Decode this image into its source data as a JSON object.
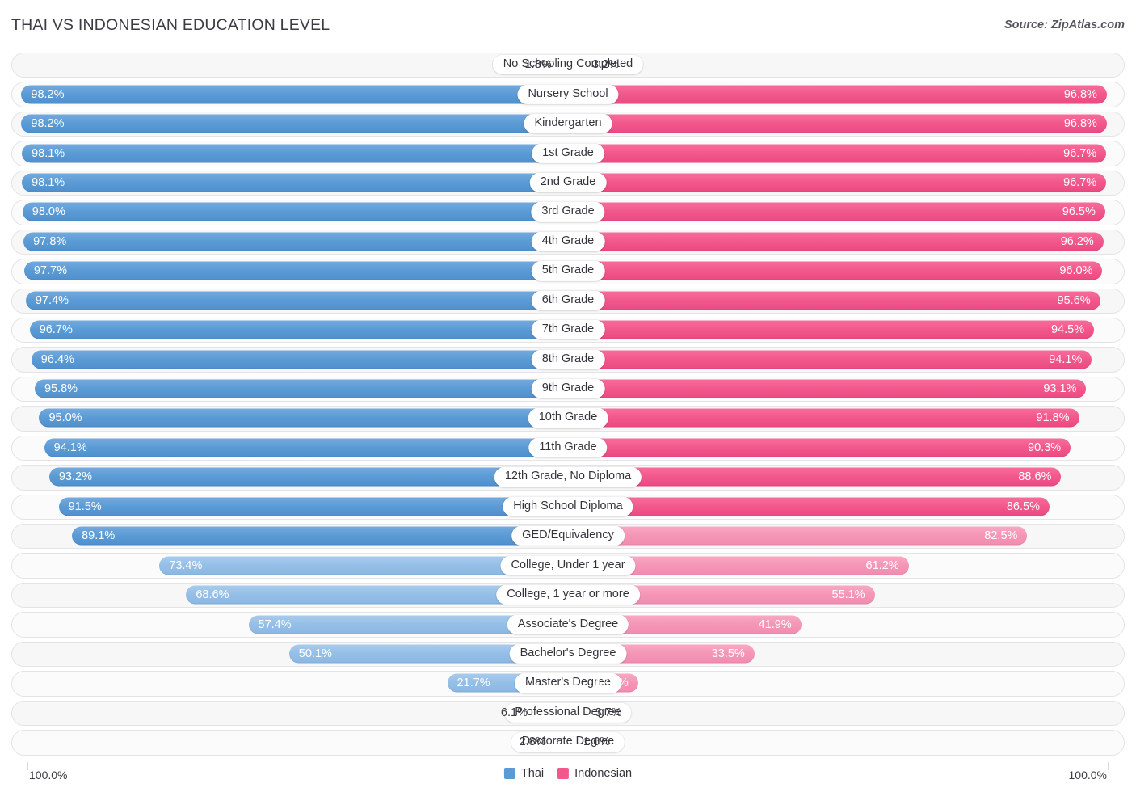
{
  "header": {
    "title": "THAI VS INDONESIAN EDUCATION LEVEL",
    "source": "Source: ZipAtlas.com"
  },
  "footer": {
    "axis_left": "100.0%",
    "axis_right": "100.0%",
    "legend": [
      {
        "label": "Thai",
        "color": "#5b9bd5"
      },
      {
        "label": "Indonesian",
        "color": "#f2588c"
      }
    ]
  },
  "colors": {
    "thai_strong": "#5b9bd5",
    "thai_pale": "#95bfe7",
    "indonesian_strong": "#f2588c",
    "indonesian_pale": "#f595b6",
    "track": "#f7f7f8",
    "text": "#33333b"
  },
  "chart_data": {
    "type": "bar",
    "orientation": "horizontal-diverging",
    "title": "THAI VS INDONESIAN EDUCATION LEVEL",
    "xlabel": "",
    "ylabel": "",
    "xlim": [
      0,
      100
    ],
    "grid": false,
    "legend_position": "bottom-center",
    "axis_max_label": "100.0%",
    "categories": [
      "No Schooling Completed",
      "Nursery School",
      "Kindergarten",
      "1st Grade",
      "2nd Grade",
      "3rd Grade",
      "4th Grade",
      "5th Grade",
      "6th Grade",
      "7th Grade",
      "8th Grade",
      "9th Grade",
      "10th Grade",
      "11th Grade",
      "12th Grade, No Diploma",
      "High School Diploma",
      "GED/Equivalency",
      "College, Under 1 year",
      "College, 1 year or more",
      "Associate's Degree",
      "Bachelor's Degree",
      "Master's Degree",
      "Professional Degree",
      "Doctorate Degree"
    ],
    "series": [
      {
        "name": "Thai",
        "color": "#5b9bd5",
        "side": "left",
        "values": [
          1.8,
          98.2,
          98.2,
          98.1,
          98.1,
          98.0,
          97.8,
          97.7,
          97.4,
          96.7,
          96.4,
          95.8,
          95.0,
          94.1,
          93.2,
          91.5,
          89.1,
          73.4,
          68.6,
          57.4,
          50.1,
          21.7,
          6.1,
          2.8
        ],
        "labels": [
          "1.8%",
          "98.2%",
          "98.2%",
          "98.1%",
          "98.1%",
          "98.0%",
          "97.8%",
          "97.7%",
          "97.4%",
          "96.7%",
          "96.4%",
          "95.8%",
          "95.0%",
          "94.1%",
          "93.2%",
          "91.5%",
          "89.1%",
          "73.4%",
          "68.6%",
          "57.4%",
          "50.1%",
          "21.7%",
          "6.1%",
          "2.8%"
        ]
      },
      {
        "name": "Indonesian",
        "color": "#f2588c",
        "side": "right",
        "values": [
          3.2,
          96.8,
          96.8,
          96.7,
          96.7,
          96.5,
          96.2,
          96.0,
          95.6,
          94.5,
          94.1,
          93.1,
          91.8,
          90.3,
          88.6,
          86.5,
          82.5,
          61.2,
          55.1,
          41.9,
          33.5,
          12.6,
          3.7,
          1.6
        ],
        "labels": [
          "3.2%",
          "96.8%",
          "96.8%",
          "96.7%",
          "96.7%",
          "96.5%",
          "96.2%",
          "96.0%",
          "95.6%",
          "94.5%",
          "94.1%",
          "93.1%",
          "91.8%",
          "90.3%",
          "88.6%",
          "86.5%",
          "82.5%",
          "61.2%",
          "55.1%",
          "41.9%",
          "33.5%",
          "12.6%",
          "3.7%",
          "1.6%"
        ]
      }
    ]
  }
}
